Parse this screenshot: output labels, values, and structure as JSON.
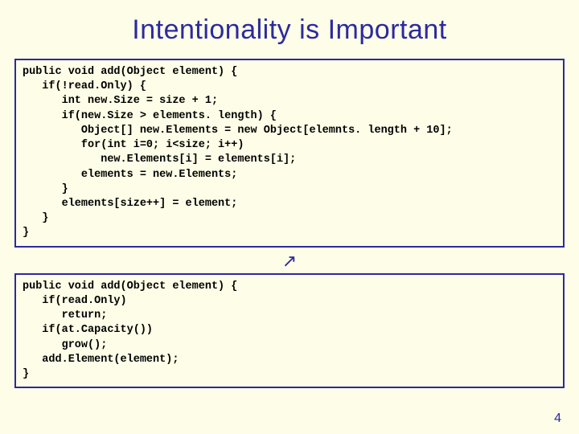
{
  "title": "Intentionality is Important",
  "code_top": "public void add(Object element) {\n   if(!read.Only) {\n      int new.Size = size + 1;\n      if(new.Size > elements. length) {\n         Object[] new.Elements = new Object[elemnts. length + 10];\n         for(int i=0; i<size; i++)\n            new.Elements[i] = elements[i];\n         elements = new.Elements;\n      }\n      elements[size++] = element;\n   }\n}",
  "arrow": "↗",
  "code_bottom": "public void add(Object element) {\n   if(read.Only)\n      return;\n   if(at.Capacity())\n      grow();\n   add.Element(element);\n}",
  "page_number": "4"
}
